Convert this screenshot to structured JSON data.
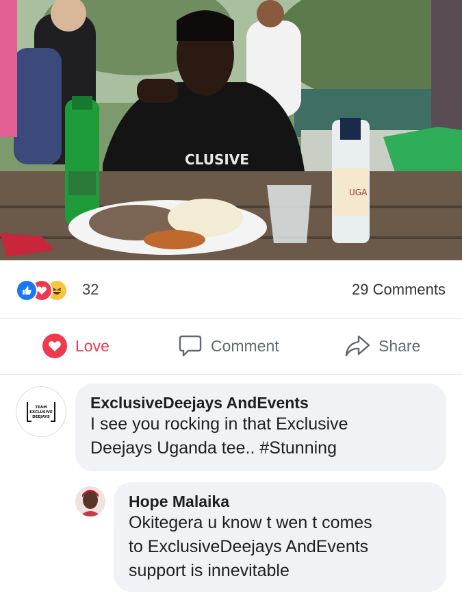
{
  "post": {
    "reactions": {
      "icons": [
        "like-icon",
        "love-icon",
        "haha-icon"
      ],
      "count": "32"
    },
    "comments_count": "29 Comments"
  },
  "actions": {
    "love_label": "Love",
    "comment_label": "Comment",
    "share_label": "Share"
  },
  "comments": [
    {
      "author": "ExclusiveDeejays AndEvents",
      "text": "I see you rocking in that Exclusive\nDeejays Uganda tee.. #Stunning",
      "avatar_lines": [
        "TEAM",
        "EXCLUSIVE",
        "DEEJAYS"
      ]
    },
    {
      "author": "Hope Malaika",
      "text": "Okitegera u know t wen t comes\nto ExclusiveDeejays AndEvents\nsupport is innevitable"
    }
  ],
  "colors": {
    "love_red": "#f0384f",
    "like_blue": "#1877f2",
    "haha_yellow": "#f7c53d",
    "bubble_gray": "#f0f2f5"
  }
}
